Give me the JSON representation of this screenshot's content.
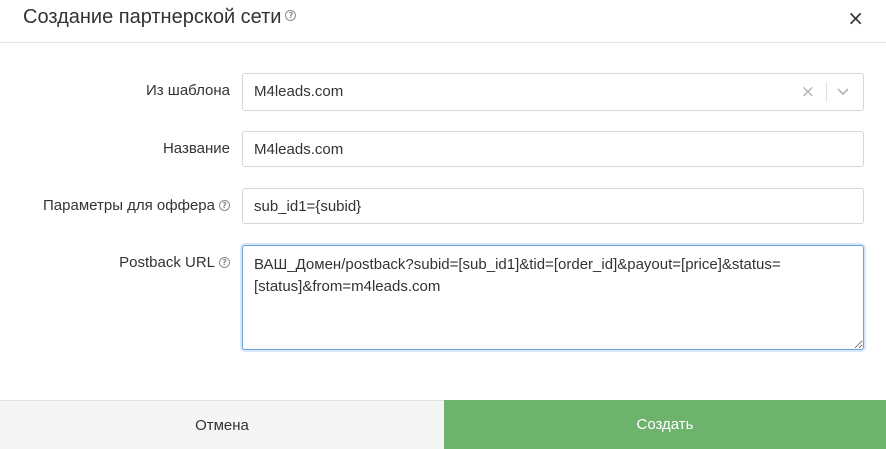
{
  "modal": {
    "title": "Создание партнерской сети",
    "help_glyph": "?",
    "close_glyph": "×"
  },
  "form": {
    "template": {
      "label": "Из шаблона",
      "value": "M4leads.com",
      "clear_glyph": "×"
    },
    "name": {
      "label": "Название",
      "value": "M4leads.com"
    },
    "offer_params": {
      "label": "Параметры для оффера",
      "value": "sub_id1={subid}"
    },
    "postback": {
      "label": "Postback URL",
      "value": "ВАШ_Домен/postback?subid=[sub_id1]&tid=[order_id]&payout=[price]&status=[status]&from=m4leads.com"
    }
  },
  "footer": {
    "cancel_label": "Отмена",
    "create_label": "Создать"
  },
  "colors": {
    "accent_green": "#6db36e",
    "focus_border": "#6ea1d8"
  }
}
